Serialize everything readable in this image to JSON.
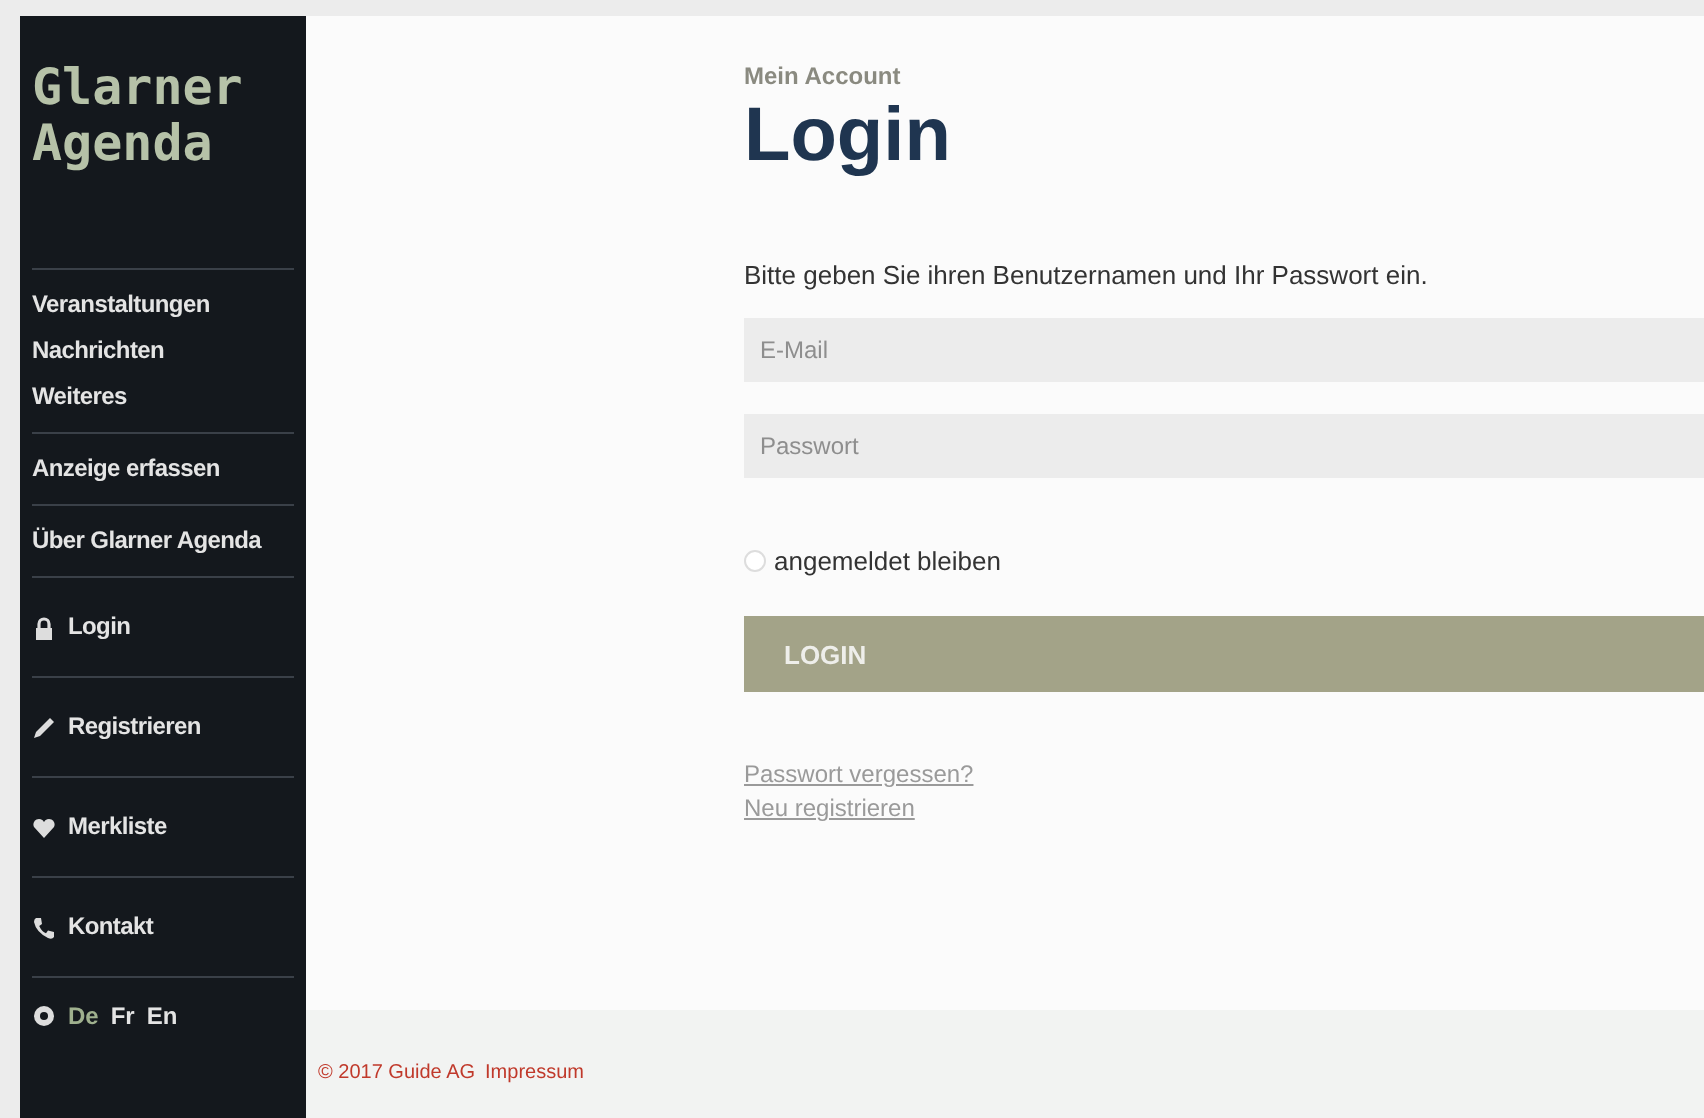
{
  "sidebar": {
    "logo": [
      "Glarner",
      "Agenda"
    ],
    "groups": [
      {
        "items": [
          {
            "label": "Veranstaltungen",
            "kind": "text"
          },
          {
            "label": "Nachrichten",
            "kind": "text"
          },
          {
            "label": "Weiteres",
            "kind": "text"
          }
        ]
      },
      {
        "items": [
          {
            "label": "Anzeige erfassen",
            "kind": "text"
          }
        ]
      },
      {
        "items": [
          {
            "label": "Über Glarner Agenda",
            "kind": "text"
          }
        ]
      },
      {
        "items": [
          {
            "label": "Login",
            "kind": "lock"
          }
        ]
      },
      {
        "items": [
          {
            "label": "Registrieren",
            "kind": "pencil"
          }
        ]
      },
      {
        "items": [
          {
            "label": "Merkliste",
            "kind": "heart"
          }
        ]
      },
      {
        "items": [
          {
            "label": "Kontakt",
            "kind": "phone"
          }
        ]
      }
    ],
    "languages": [
      {
        "label": "De",
        "selected": true
      },
      {
        "label": "Fr",
        "selected": false
      },
      {
        "label": "En",
        "selected": false
      }
    ]
  },
  "main": {
    "breadcrumb": "Mein Account",
    "title": "Login",
    "instruction": "Bitte geben Sie ihren Benutzernamen und Ihr Passwort ein.",
    "email": {
      "placeholder": "E-Mail"
    },
    "password": {
      "placeholder": "Passwort"
    },
    "remember": {
      "label": "angemeldet bleiben",
      "checked": false
    },
    "button": "LOGIN",
    "links": [
      "Passwort vergessen?",
      "Neu registrieren"
    ]
  },
  "footer": {
    "copyright": "© 2017 Guide AG",
    "link": "Impressum"
  }
}
